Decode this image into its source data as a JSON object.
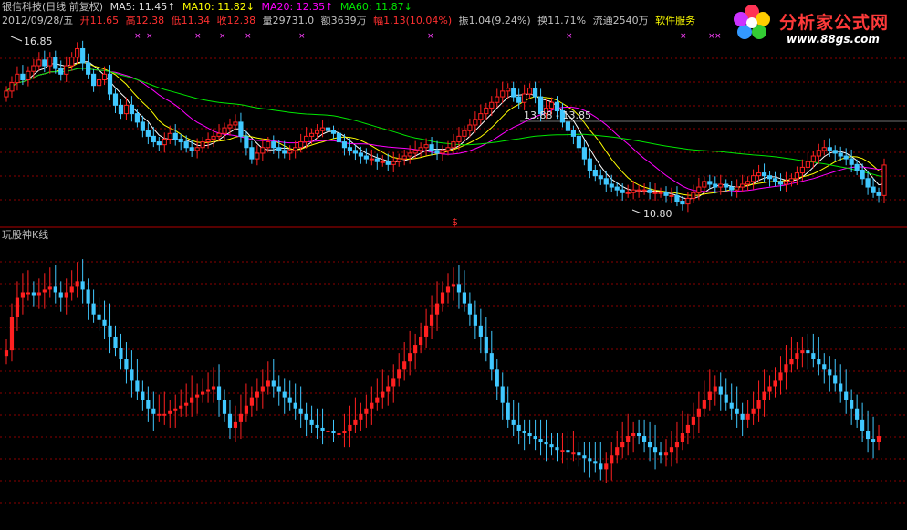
{
  "header": {
    "stock_name": "银信科技(日线 前复权)",
    "ma5": "MA5: 11.45↑",
    "ma10": "MA10: 11.82↓",
    "ma20": "MA20: 12.35↑",
    "ma60": "MA60: 11.87↓",
    "date": "2012/09/28/五",
    "open": "开11.65",
    "high": "高12.38",
    "low": "低11.34",
    "close": "收12.38",
    "volume": "量29731.0",
    "amount": "额3639万",
    "change": "幅1.13(10.04%)",
    "amplitude": "振1.04(9.24%)",
    "turnover": "换11.71%",
    "float": "流通2540万",
    "software": "软件服务"
  },
  "panel2": {
    "title": "玩股神K线"
  },
  "annotations": {
    "high_label": "16.85",
    "low_label": "10.80",
    "range_label": "13.88 - 13.85",
    "marker": "$"
  },
  "watermark": {
    "title": "分析家公式网",
    "url": "www.88gs.com"
  },
  "colors": {
    "ma5": "#ffffff",
    "ma10": "#ffff00",
    "ma20": "#ff00ff",
    "ma60": "#00e600",
    "up": "#ff2020",
    "down": "#40c8ff",
    "grid": "#8b0000"
  },
  "chart_data": [
    {
      "type": "candlestick",
      "panel": "price",
      "ylim": [
        10.6,
        17.0
      ],
      "x": [
        1,
        2,
        3,
        4,
        5,
        6,
        7,
        8,
        9,
        10,
        11,
        12,
        13,
        14,
        15,
        16,
        17,
        18,
        19,
        20,
        21,
        22,
        23,
        24,
        25,
        26,
        27,
        28,
        29,
        30,
        31,
        32,
        33,
        34,
        35,
        36,
        37,
        38,
        39,
        40,
        41,
        42,
        43,
        44,
        45,
        46,
        47,
        48,
        49,
        50,
        51,
        52,
        53,
        54,
        55,
        56,
        57,
        58,
        59,
        60,
        61,
        62,
        63,
        64,
        65,
        66,
        67,
        68,
        69,
        70,
        71,
        72,
        73,
        74,
        75,
        76,
        77,
        78,
        79,
        80,
        81,
        82,
        83,
        84,
        85,
        86,
        87,
        88,
        89,
        90,
        91,
        92,
        93,
        94,
        95,
        96,
        97,
        98,
        99,
        100,
        101,
        102,
        103,
        104,
        105,
        106,
        107,
        108,
        109,
        110,
        111,
        112,
        113,
        114,
        115,
        116,
        117,
        118,
        119,
        120,
        121,
        122,
        123,
        124,
        125,
        126,
        127,
        128,
        129,
        130,
        131,
        132,
        133,
        134,
        135,
        136,
        137,
        138,
        139,
        140,
        141,
        142,
        143,
        144,
        145,
        146,
        147,
        148,
        149,
        150,
        151,
        152,
        153,
        154,
        155,
        156,
        157,
        158,
        159,
        160
      ],
      "close": [
        15.0,
        15.3,
        15.6,
        15.4,
        15.7,
        15.9,
        16.1,
        15.9,
        16.2,
        15.8,
        15.6,
        15.9,
        16.2,
        16.5,
        16.0,
        15.6,
        15.2,
        15.4,
        15.6,
        14.9,
        14.5,
        14.2,
        14.5,
        14.2,
        13.9,
        13.6,
        13.4,
        13.2,
        13.1,
        13.3,
        13.5,
        13.3,
        13.2,
        13.0,
        12.9,
        13.0,
        13.2,
        13.3,
        13.4,
        13.5,
        13.7,
        13.8,
        13.9,
        13.4,
        13.0,
        12.6,
        12.8,
        13.0,
        13.2,
        13.0,
        12.9,
        12.8,
        12.9,
        13.0,
        13.2,
        13.4,
        13.5,
        13.6,
        13.7,
        13.6,
        13.5,
        13.2,
        13.0,
        12.9,
        12.8,
        12.7,
        12.6,
        12.6,
        12.5,
        12.5,
        12.4,
        12.5,
        12.6,
        12.7,
        12.8,
        12.9,
        13.0,
        13.1,
        12.9,
        12.8,
        12.9,
        13.0,
        13.2,
        13.4,
        13.6,
        13.8,
        14.0,
        14.2,
        14.4,
        14.6,
        14.8,
        15.0,
        15.1,
        14.8,
        14.6,
        14.9,
        15.1,
        14.8,
        14.2,
        14.4,
        14.6,
        14.3,
        13.9,
        13.6,
        13.4,
        13.0,
        12.6,
        12.2,
        12.0,
        11.9,
        11.7,
        11.6,
        11.5,
        11.4,
        11.4,
        11.5,
        11.5,
        11.5,
        11.4,
        11.4,
        11.4,
        11.3,
        11.3,
        11.1,
        11.0,
        11.2,
        11.4,
        11.6,
        11.8,
        11.7,
        11.6,
        11.7,
        11.6,
        11.5,
        11.6,
        11.7,
        11.8,
        12.0,
        12.1,
        12.0,
        11.9,
        11.8,
        11.7,
        11.8,
        11.9,
        12.1,
        12.3,
        12.5,
        12.7,
        12.9,
        13.0,
        12.9,
        12.8,
        12.7,
        12.6,
        12.4,
        12.2,
        11.9,
        11.6,
        11.4,
        11.3,
        12.38
      ],
      "series": [
        {
          "name": "MA5: 11.45"
        },
        {
          "name": "MA10: 11.82"
        },
        {
          "name": "MA20: 12.35"
        },
        {
          "name": "MA60: 11.87"
        }
      ]
    },
    {
      "type": "candlestick",
      "panel": "indicator",
      "title": "玩股神K线",
      "ylim": [
        0,
        100
      ],
      "values": [
        63,
        75,
        82,
        84,
        84,
        83,
        84,
        85,
        86,
        84,
        82,
        84,
        86,
        88,
        85,
        80,
        76,
        74,
        72,
        68,
        64,
        60,
        56,
        52,
        48,
        45,
        42,
        40,
        40,
        40,
        41,
        42,
        43,
        44,
        46,
        47,
        48,
        49,
        50,
        45,
        40,
        35,
        37,
        40,
        43,
        46,
        48,
        50,
        52,
        50,
        48,
        46,
        44,
        42,
        40,
        38,
        36,
        35,
        34,
        34,
        33,
        33,
        34,
        36,
        38,
        40,
        42,
        44,
        46,
        48,
        50,
        53,
        56,
        59,
        62,
        65,
        68,
        72,
        76,
        80,
        84,
        86,
        87,
        84,
        80,
        76,
        72,
        68,
        62,
        56,
        50,
        44,
        38,
        36,
        34,
        33,
        32,
        31,
        30,
        29,
        28,
        27,
        27,
        26,
        26,
        25,
        24,
        23,
        22,
        20,
        22,
        25,
        28,
        30,
        32,
        33,
        32,
        30,
        28,
        26,
        25,
        26,
        28,
        30,
        33,
        36,
        39,
        42,
        45,
        48,
        50,
        47,
        44,
        42,
        40,
        38,
        40,
        42,
        45,
        48,
        50,
        52,
        55,
        58,
        60,
        62,
        63,
        62,
        60,
        58,
        56,
        54,
        51,
        48,
        45,
        42,
        38,
        34,
        31,
        30,
        32
      ]
    }
  ]
}
